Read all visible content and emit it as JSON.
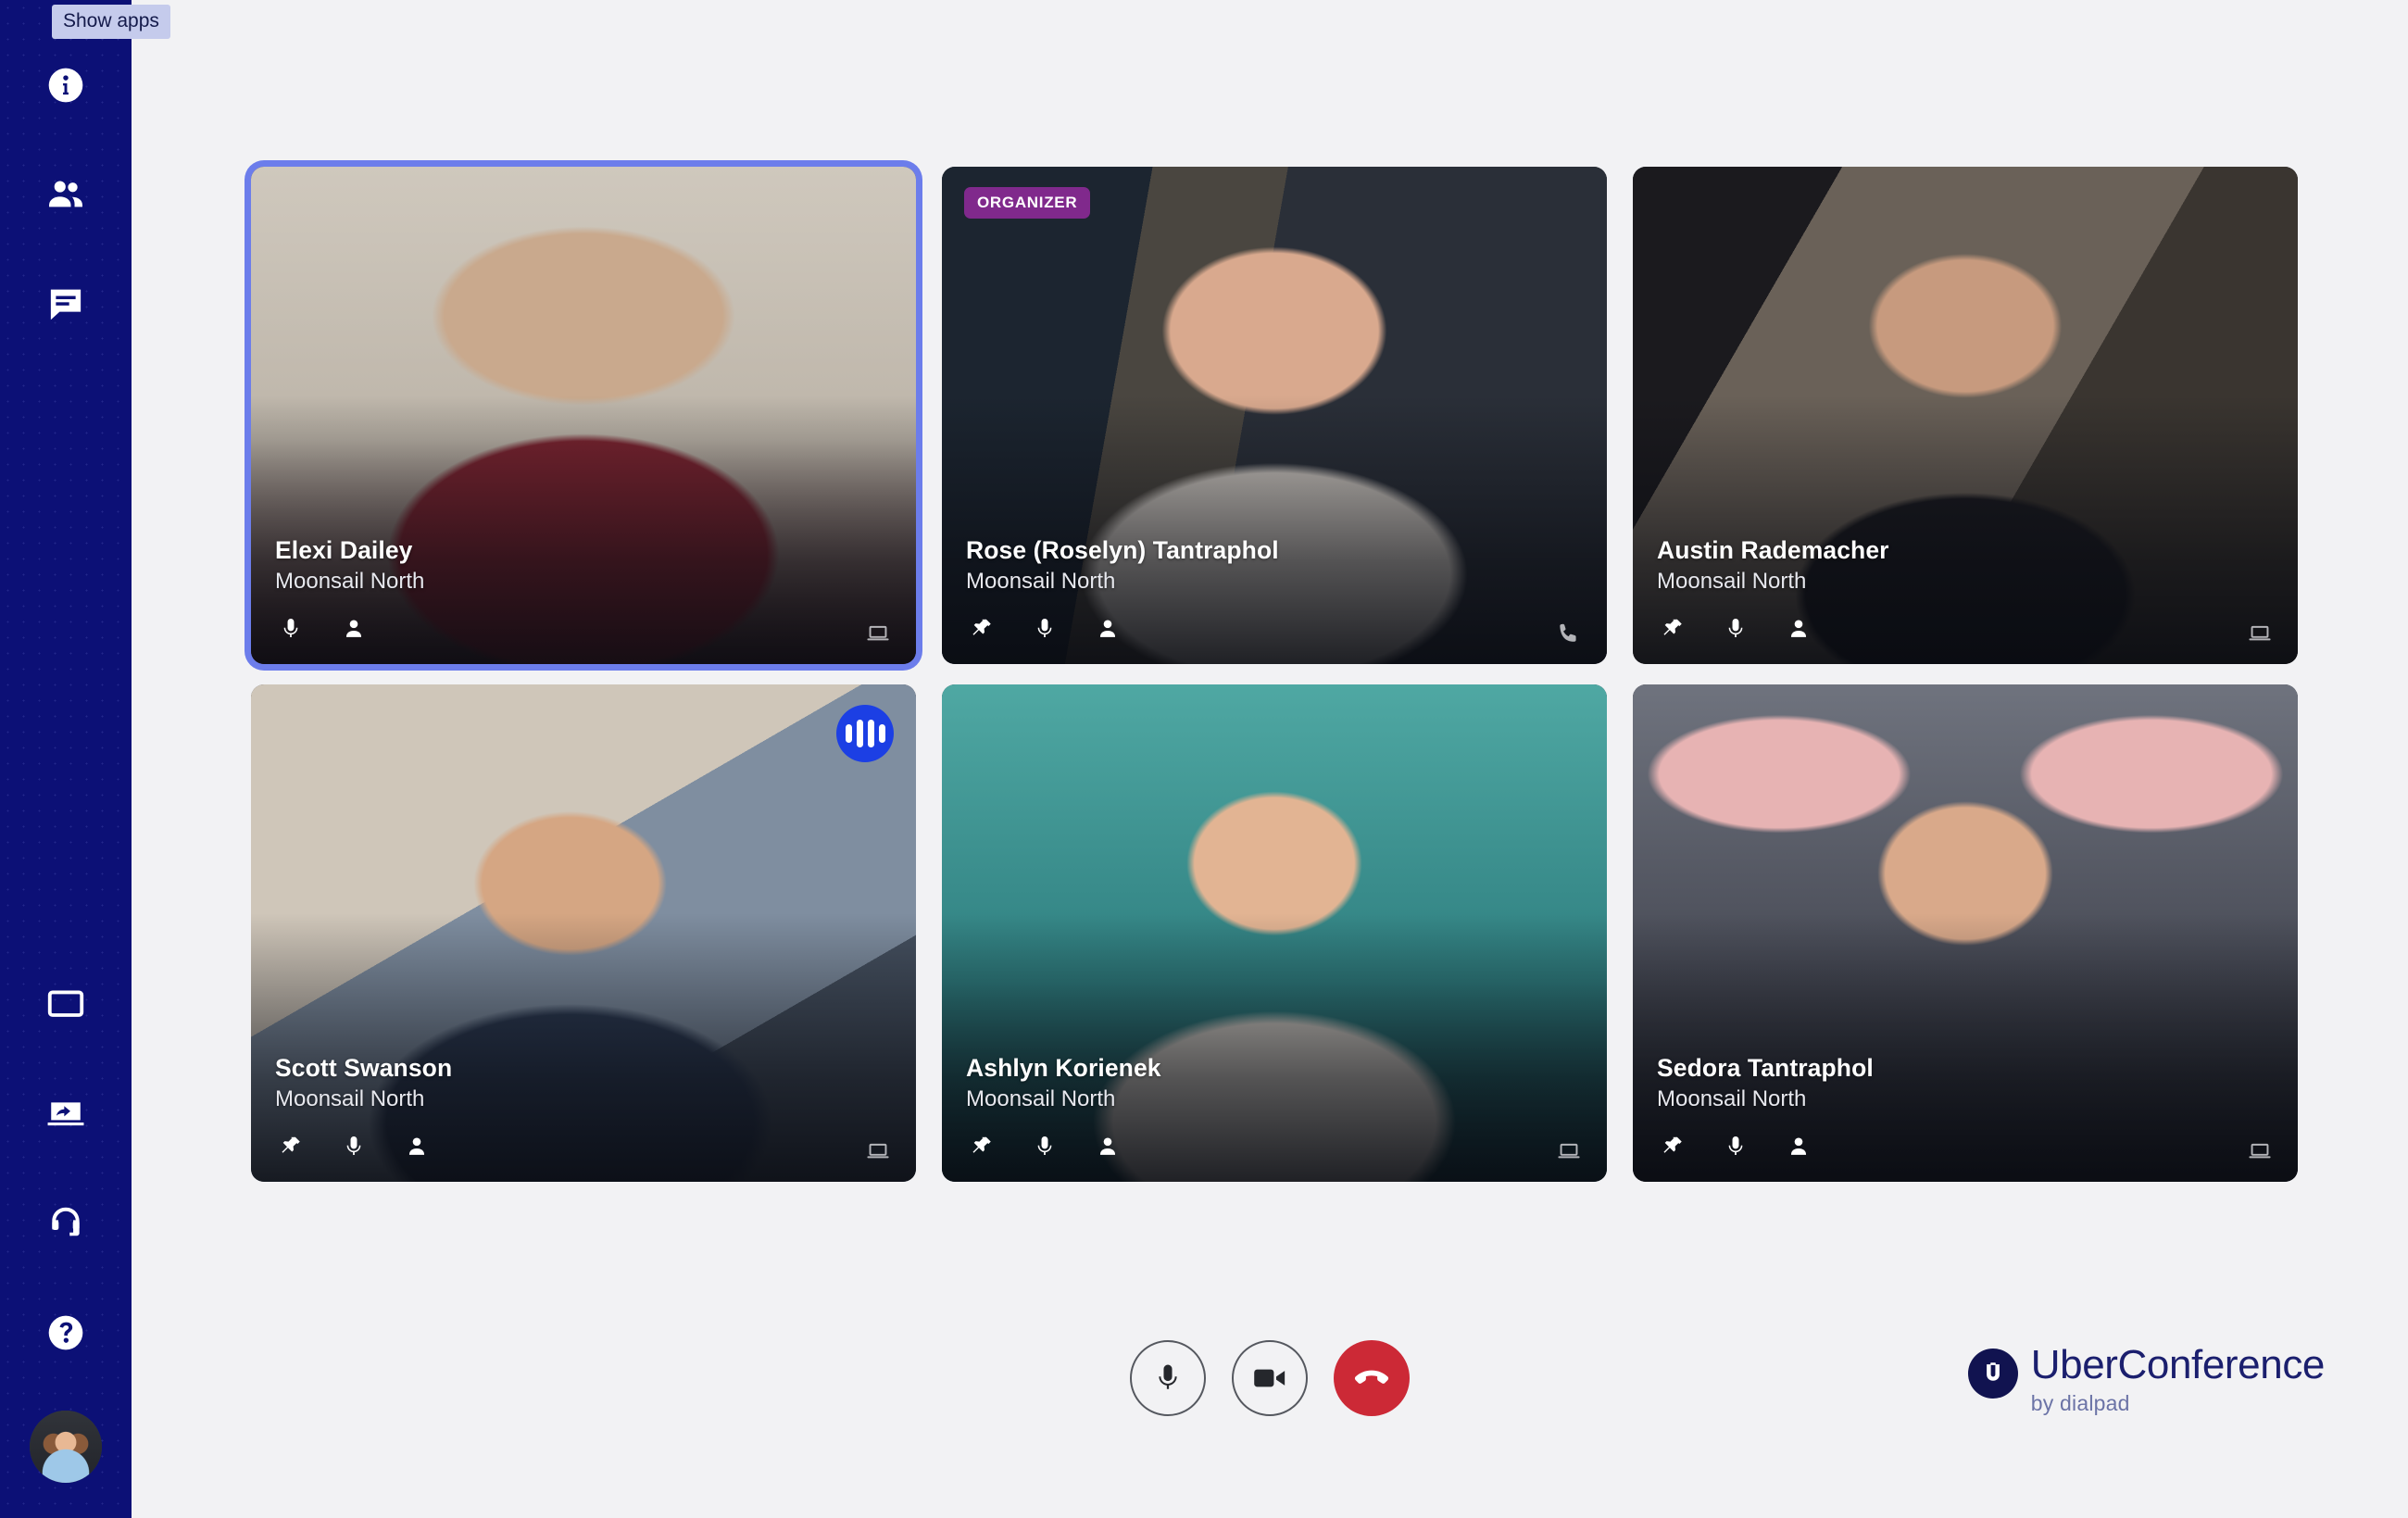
{
  "app": {
    "brand_name": "UberConference",
    "brand_sub": "by dialpad",
    "background_color": "#f2f2f4"
  },
  "tooltip": {
    "text": "Show apps"
  },
  "sidebar": {
    "background_color": "#0c1076",
    "top_items": [
      {
        "icon": "info-icon",
        "label": "Meeting info"
      },
      {
        "icon": "people-icon",
        "label": "Participants"
      },
      {
        "icon": "chat-icon",
        "label": "Chat"
      }
    ],
    "bottom_items": [
      {
        "icon": "screen-icon",
        "label": "Screen"
      },
      {
        "icon": "screen-share-icon",
        "label": "Share screen"
      },
      {
        "icon": "headset-icon",
        "label": "Audio support"
      },
      {
        "icon": "help-icon",
        "label": "Help"
      }
    ],
    "avatar": {
      "icon": "avatar",
      "label": "Your profile"
    }
  },
  "grid": {
    "selected_border_color": "#6c7deb",
    "organizer_badge_color": "#80298c",
    "speaking_indicator_color": "#1c3fe4",
    "participants": [
      {
        "name": "Elexi Dailey",
        "organization": "Moonsail North",
        "selected": true,
        "organizer": false,
        "organizer_label": "",
        "speaking": false,
        "device": "laptop-icon",
        "actions": [
          "mic-icon",
          "person-icon"
        ],
        "video_class": "v-elexi"
      },
      {
        "name": "Rose (Roselyn) Tantraphol",
        "organization": "Moonsail North",
        "selected": false,
        "organizer": true,
        "organizer_label": "ORGANIZER",
        "speaking": false,
        "device": "phone-icon",
        "actions": [
          "pin-icon",
          "mic-icon",
          "person-icon"
        ],
        "video_class": "v-rose"
      },
      {
        "name": "Austin Rademacher",
        "organization": "Moonsail North",
        "selected": false,
        "organizer": false,
        "organizer_label": "",
        "speaking": false,
        "device": "laptop-icon",
        "actions": [
          "pin-icon",
          "mic-icon",
          "person-icon"
        ],
        "video_class": "v-austin"
      },
      {
        "name": "Scott Swanson",
        "organization": "Moonsail North",
        "selected": false,
        "organizer": false,
        "organizer_label": "",
        "speaking": true,
        "device": "laptop-icon",
        "actions": [
          "pin-icon",
          "mic-icon",
          "person-icon"
        ],
        "video_class": "v-scott"
      },
      {
        "name": "Ashlyn Korienek",
        "organization": "Moonsail North",
        "selected": false,
        "organizer": false,
        "organizer_label": "",
        "speaking": false,
        "device": "laptop-icon",
        "actions": [
          "pin-icon",
          "mic-icon",
          "person-icon"
        ],
        "video_class": "v-ashlyn"
      },
      {
        "name": "Sedora Tantraphol",
        "organization": "Moonsail North",
        "selected": false,
        "organizer": false,
        "organizer_label": "",
        "speaking": false,
        "device": "laptop-icon",
        "actions": [
          "pin-icon",
          "mic-icon",
          "person-icon"
        ],
        "video_class": "v-sedora"
      }
    ]
  },
  "controls": [
    {
      "icon": "mic-icon",
      "label": "Mute",
      "style": "outline"
    },
    {
      "icon": "camera-icon",
      "label": "Stop video",
      "style": "outline"
    },
    {
      "icon": "hangup-icon",
      "label": "Leave call",
      "style": "danger",
      "color": "#cc2936"
    }
  ]
}
